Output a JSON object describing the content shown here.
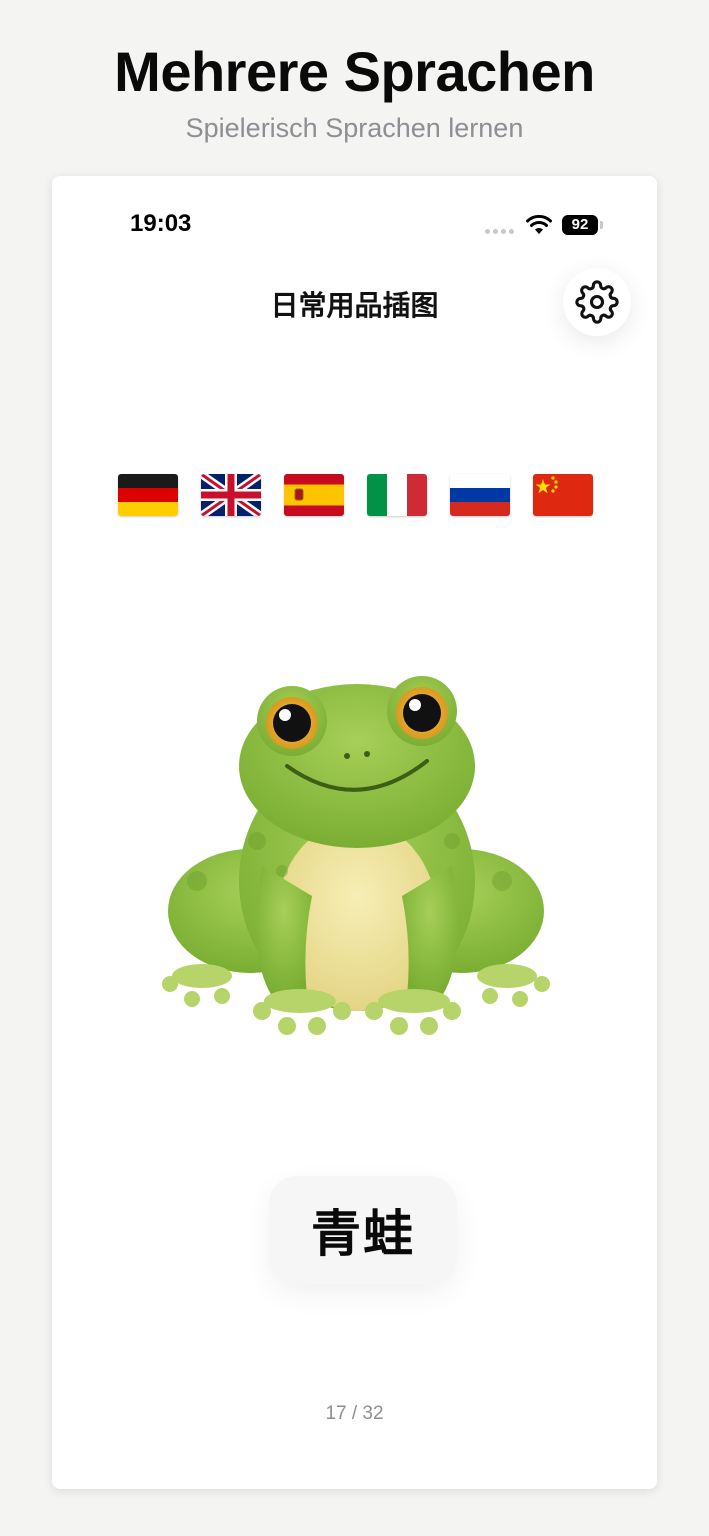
{
  "promo": {
    "title": "Mehrere Sprachen",
    "subtitle": "Spielerisch Sprachen lernen"
  },
  "status_bar": {
    "time": "19:03",
    "battery_level": "92"
  },
  "nav": {
    "title": "日常用品插图",
    "settings_icon": "gear-icon"
  },
  "languages": [
    {
      "code": "de",
      "icon": "germany-flag"
    },
    {
      "code": "en",
      "icon": "uk-flag"
    },
    {
      "code": "es",
      "icon": "spain-flag"
    },
    {
      "code": "it",
      "icon": "italy-flag"
    },
    {
      "code": "ru",
      "icon": "russia-flag"
    },
    {
      "code": "zh",
      "icon": "china-flag"
    }
  ],
  "card": {
    "image": "frog-illustration",
    "word": "青蛙"
  },
  "pagination": {
    "text": "17 / 32"
  },
  "colors": {
    "background": "#f4f4f3",
    "card": "#ffffff",
    "subtitle": "#8e8e93",
    "frog_green": "#8cbf3f",
    "frog_belly": "#f0e4a0"
  }
}
